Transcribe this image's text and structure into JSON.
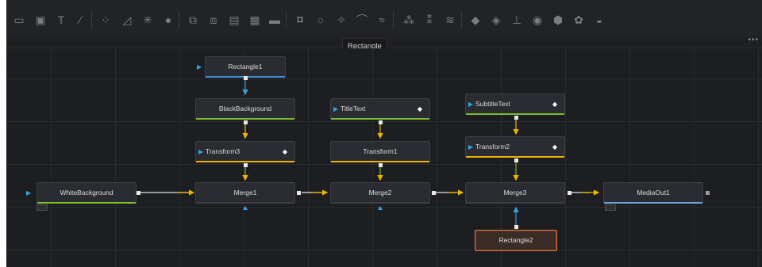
{
  "toolbar": {
    "icons": [
      "background-icon",
      "image-icon",
      "text-icon",
      "paint-icon",
      "blur-icon",
      "color-corrector-icon",
      "glow-icon",
      "drop-icon",
      "merge-icon",
      "transform-icon",
      "crop-icon",
      "loader-icon",
      "saver-icon",
      "rectangle-mask-icon",
      "ellipse-mask-icon",
      "polygon-mask-icon",
      "bspline-mask-icon",
      "paint-mask-icon",
      "particle-emitter-icon",
      "particle-render-icon",
      "particle-force-icon",
      "shape3d-icon",
      "merge3d-icon",
      "camera3d-icon",
      "light3d-icon",
      "renderer3d-icon",
      "fbx-icon",
      "imageplane3d-icon"
    ],
    "tooltip": "Rectangle",
    "more_glyph": "•••"
  },
  "nodes": {
    "rectangle1": "Rectangle1",
    "black_background": "BlackBackground",
    "title_text": "TitleText",
    "subtitle_text": "SubtitleText",
    "transform3": "Transform3",
    "transform1": "Transform1",
    "transform2": "Transform2",
    "white_background": "WhiteBackground",
    "merge1": "Merge1",
    "merge2": "Merge2",
    "merge3": "Merge3",
    "media_out1": "MediaOut1",
    "rectangle2": "Rectangle2"
  },
  "colors": {
    "canvas": "#1d1e21",
    "node_bg": "#2a2c31",
    "selected_border": "#e0753a",
    "mask_line": "#3e8fd6",
    "effect_line": "#f0b400",
    "generator_line": "#7dbb2f",
    "output_line": "#6aa6df",
    "flow_yellow": "#f0b400",
    "flow_blue": "#3a9de0",
    "flow_white": "#e6e6e6"
  }
}
